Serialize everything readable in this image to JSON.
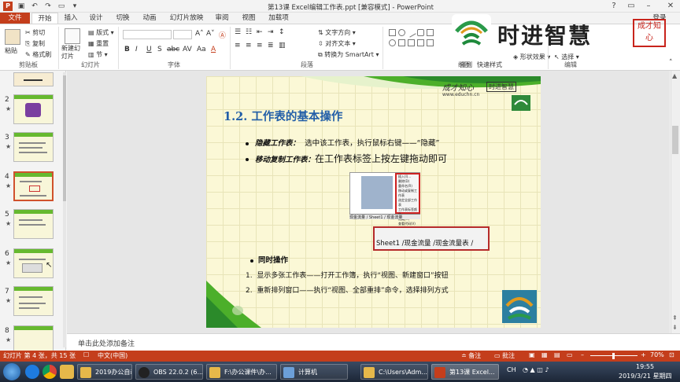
{
  "window": {
    "title": "第13课 Excel编辑工作表.ppt [兼容模式] - PowerPoint",
    "login": "登录"
  },
  "tabs": [
    "文件",
    "开始",
    "插入",
    "设计",
    "切换",
    "动画",
    "幻灯片放映",
    "审阅",
    "视图",
    "加载项"
  ],
  "ribbon": {
    "clipboard": {
      "paste": "粘贴",
      "cut": "剪切",
      "copy": "复制",
      "format_painter": "格式刷",
      "label": "剪贴板"
    },
    "slides": {
      "new_slide": "新建幻灯片",
      "layout": "版式",
      "reset": "重置",
      "section": "节",
      "label": "幻灯片"
    },
    "font": {
      "label": "字体",
      "buttons": [
        "B",
        "I",
        "U",
        "S",
        "abc",
        "AV",
        "Aa",
        "A"
      ]
    },
    "paragraph": {
      "text_direction": "文字方向",
      "align_text": "对齐文本",
      "smartart": "转换为 SmartArt",
      "label": "段落"
    },
    "drawing": {
      "arrange": "排列",
      "quick_styles": "快速样式",
      "shape_effects": "形状效果",
      "label": "绘图"
    },
    "editing": {
      "select": "选择",
      "label": "编辑"
    }
  },
  "logo": {
    "text": "时进智慧",
    "seal": "成才知心"
  },
  "thumbnails": [
    {
      "num": "2"
    },
    {
      "num": "3"
    },
    {
      "num": "4"
    },
    {
      "num": "5"
    },
    {
      "num": "6"
    },
    {
      "num": "7"
    },
    {
      "num": "8"
    }
  ],
  "slide": {
    "header_brand": "成才知心",
    "header_brand2": "时进智慧",
    "header_url": "www.educhn.cn",
    "title": "1.2.  工作表的基本操作",
    "bullet1_label": "隐藏工作表：",
    "bullet1_text": "选中该工作表，执行鼠标右键——“隐藏”",
    "bullet2_label": "移动复制工作表：",
    "bullet2_text": "在工作表标签上按左键拖动即可",
    "shot1_menu": [
      "插入(I)...",
      "删除(D)",
      "重命名(R)",
      "移动或复制工作表",
      "选定全部工作表",
      "工作表标签颜色",
      "隐藏(H)",
      "查看代码(V)"
    ],
    "shot1_tabs": "现金流量 / Sheet1 / 现金流量",
    "shot2_tabs": "Sheet1 /现金流量 /现金流量表 /",
    "sub_bullet": "同时操作",
    "num1": "显示多张工作表——打开工作簿，执行“视图、新建窗口”按钮",
    "num2": "重新排列窗口——执行“视图、全部重排”命令，选择排列方式"
  },
  "notes_placeholder": "单击此处添加备注",
  "status": {
    "slide_info": "幻灯片 第 4 张，共 15 张",
    "lang": "中文(中国)",
    "notes": "备注",
    "comments": "批注",
    "zoom": "70%"
  },
  "taskbar": {
    "items": [
      "2019办公自动化",
      "OBS 22.0.2 (6...",
      "F:\\办公课件\\办...",
      "计算机",
      "C:\\Users\\Adm...",
      "第13课 Excel..."
    ],
    "tray_text": "CH",
    "time": "19:55",
    "date": "2019/3/21 星期四"
  },
  "colors": {
    "accent": "#c43e1c",
    "title_blue": "#225ea8",
    "slide_bg": "#fbf8d6",
    "green": "#4caf2a"
  }
}
